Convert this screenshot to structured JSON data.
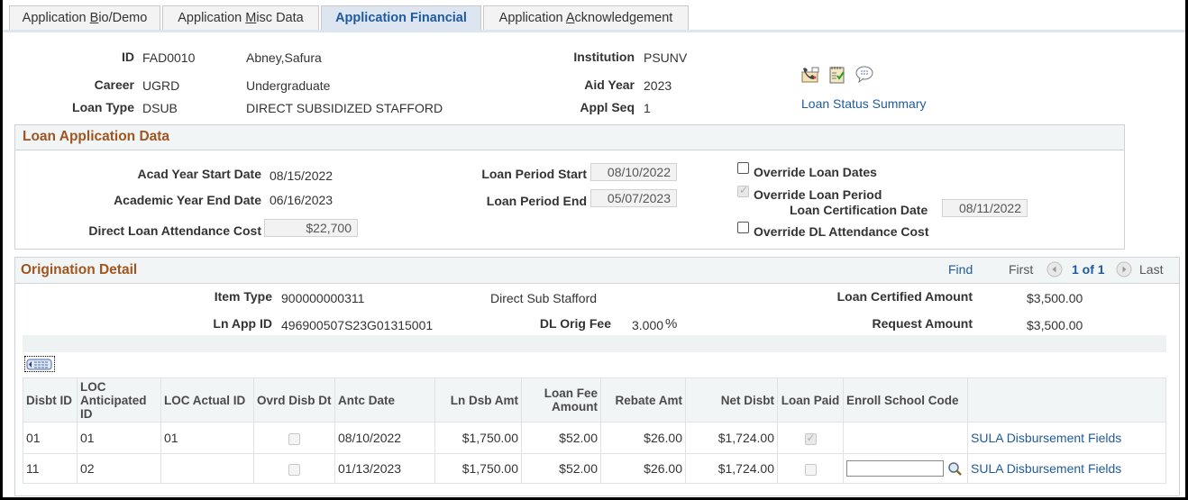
{
  "tabs": [
    {
      "label_pre": "Application ",
      "label_ul": "B",
      "label_post": "io/Demo",
      "active": false
    },
    {
      "label_pre": "Application ",
      "label_ul": "M",
      "label_post": "isc Data",
      "active": false
    },
    {
      "label_pre": "Application Financial",
      "label_ul": "",
      "label_post": "",
      "active": true
    },
    {
      "label_pre": "Application ",
      "label_ul": "A",
      "label_post": "cknowledgement",
      "active": false
    }
  ],
  "header": {
    "id_label": "ID",
    "id_value": "FAD0010",
    "name": "Abney,Safura",
    "career_label": "Career",
    "career_value": "UGRD",
    "career_desc": "Undergraduate",
    "loan_type_label": "Loan Type",
    "loan_type_value": "DSUB",
    "loan_type_desc": "DIRECT SUBSIDIZED STAFFORD",
    "institution_label": "Institution",
    "institution_value": "PSUNV",
    "aid_year_label": "Aid Year",
    "aid_year_value": "2023",
    "appl_seq_label": "Appl Seq",
    "appl_seq_value": "1",
    "icons": [
      "contact-icon",
      "checklist-icon",
      "comments-icon"
    ],
    "loan_status_summary_link": "Loan Status Summary"
  },
  "loan_application": {
    "title": "Loan Application Data",
    "acad_start_label": "Acad Year Start Date",
    "acad_start_value": "08/15/2022",
    "acad_end_label": "Academic Year End Date",
    "acad_end_value": "06/16/2023",
    "attendance_cost_label": "Direct Loan Attendance Cost",
    "attendance_cost_value": "$22,700",
    "loan_period_start_label": "Loan Period Start",
    "loan_period_start_value": "08/10/2022",
    "loan_period_end_label": "Loan Period End",
    "loan_period_end_value": "05/07/2023",
    "override_loan_dates_label": "Override Loan Dates",
    "override_loan_dates_checked": false,
    "override_loan_period_label": "Override Loan Period",
    "override_loan_period_checked": true,
    "loan_cert_date_label": "Loan Certification Date",
    "loan_cert_date_value": "08/11/2022",
    "override_dl_cost_label": "Override DL Attendance Cost",
    "override_dl_cost_checked": false
  },
  "origination": {
    "title": "Origination Detail",
    "find_link": "Find",
    "first_label": "First",
    "page_indicator": "1 of 1",
    "last_label": "Last",
    "item_type_label": "Item Type",
    "item_type_value": "900000000311",
    "item_type_desc": "Direct Sub Stafford",
    "ln_app_id_label": "Ln App ID",
    "ln_app_id_value": "496900507S23G01315001",
    "dl_orig_fee_label": "DL Orig Fee",
    "dl_orig_fee_value": "3.000",
    "dl_orig_fee_unit": "%",
    "loan_certified_label": "Loan Certified Amount",
    "loan_certified_value": "$3,500.00",
    "request_amount_label": "Request Amount",
    "request_amount_value": "$3,500.00"
  },
  "grid": {
    "columns": [
      "Disbt ID",
      "LOC Anticipated ID",
      "LOC Actual ID",
      "Ovrd Disb Dt",
      "Antc Date",
      "Ln Dsb Amt",
      "Loan Fee Amount",
      "Rebate Amt",
      "Net Disbt",
      "Loan Paid",
      "Enroll School Code",
      ""
    ],
    "rows": [
      {
        "disbt_id": "01",
        "loc_anticipated": "01",
        "loc_actual": "01",
        "ovrd_disb_dt": false,
        "antc_date": "08/10/2022",
        "ln_dsb_amt": "$1,750.00",
        "loan_fee": "$52.00",
        "rebate": "$26.00",
        "net_disbt": "$1,724.00",
        "loan_paid": true,
        "enroll_school_code": "",
        "link": "SULA Disbursement Fields"
      },
      {
        "disbt_id": "11",
        "loc_anticipated": "02",
        "loc_actual": "",
        "ovrd_disb_dt": false,
        "antc_date": "01/13/2023",
        "ln_dsb_amt": "$1,750.00",
        "loan_fee": "$52.00",
        "rebate": "$26.00",
        "net_disbt": "$1,724.00",
        "loan_paid": false,
        "enroll_school_code": "",
        "link": "SULA Disbursement Fields"
      }
    ]
  }
}
